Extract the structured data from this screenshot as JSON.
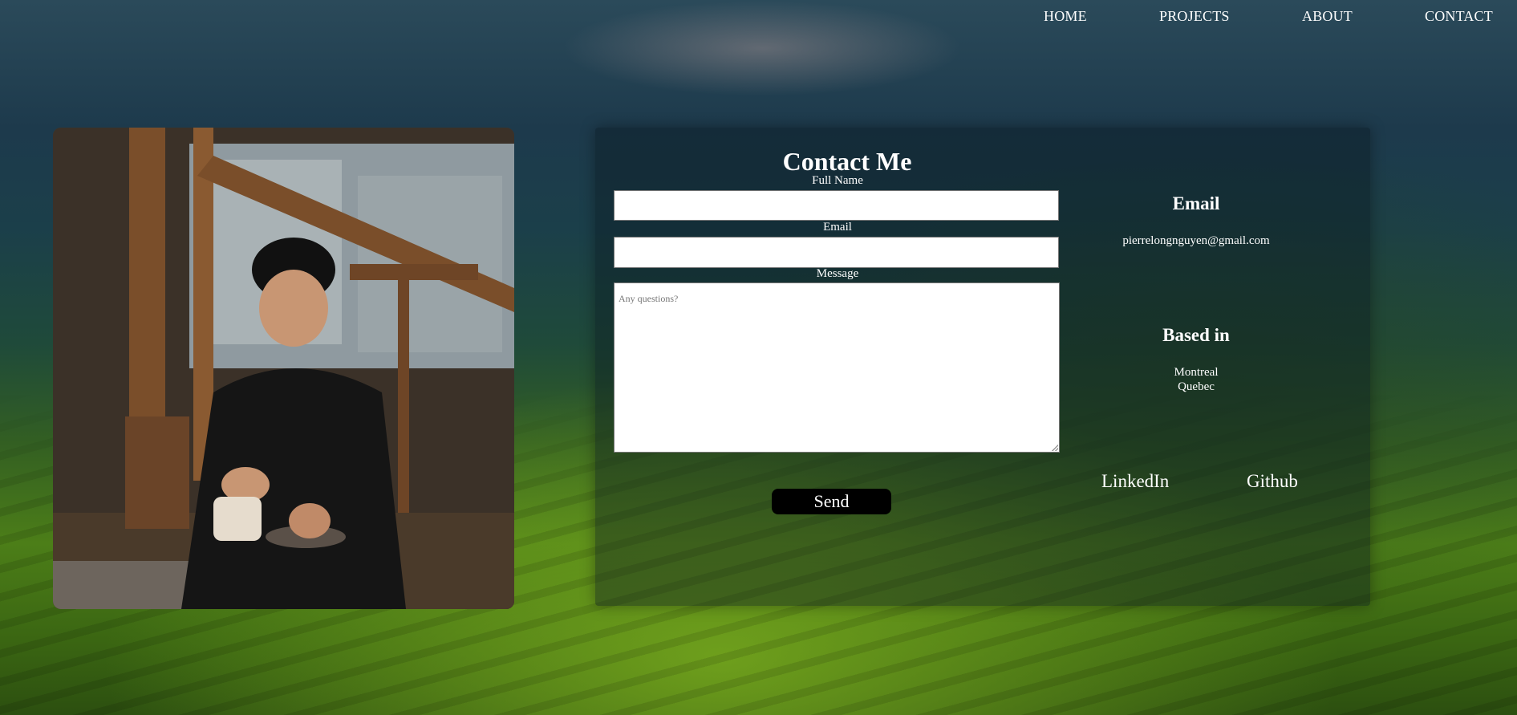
{
  "nav": {
    "items": [
      {
        "label": "HOME"
      },
      {
        "label": "PROJECTS"
      },
      {
        "label": "ABOUT"
      },
      {
        "label": "CONTACT"
      }
    ]
  },
  "photo": {
    "icon": "portrait-photo"
  },
  "contact_form": {
    "title": "Contact Me",
    "full_name_label": "Full Name",
    "full_name_value": "",
    "email_label": "Email",
    "email_value": "",
    "message_label": "Message",
    "message_placeholder": "Any questions?",
    "send_label": "Send"
  },
  "info": {
    "email_heading": "Email",
    "email_address": "pierrelongnguyen@gmail.com",
    "location_heading": "Based in",
    "city": "Montreal",
    "province": "Quebec",
    "links": [
      {
        "label": "LinkedIn"
      },
      {
        "label": "Github"
      }
    ]
  },
  "colors": {
    "text": "#ffffff",
    "button_bg": "#000000",
    "input_bg": "#ffffff"
  }
}
